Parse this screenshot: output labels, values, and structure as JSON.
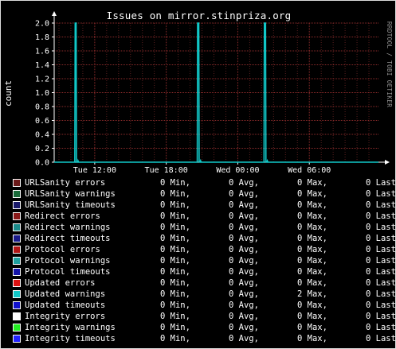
{
  "chart_data": {
    "type": "line",
    "title": "Issues on mirror.stinpriza.org",
    "ylabel": "count",
    "ylim": [
      0,
      2.0
    ],
    "yticks": [
      "0.0",
      "0.2",
      "0.4",
      "0.6",
      "0.8",
      "1.0",
      "1.2",
      "1.4",
      "1.6",
      "1.8",
      "2.0"
    ],
    "xticks": [
      "Tue 12:00",
      "Tue 18:00",
      "Wed 00:00",
      "Wed 06:00"
    ],
    "xlim_hours": [
      8.6,
      35.8
    ],
    "xtick_hours": [
      12,
      18,
      24,
      30
    ],
    "grid": true,
    "watermark": "RRDTOOL / TOBI OETIKER",
    "series": [
      {
        "name": "URLSanity errors",
        "color": "#6b1a1a",
        "min": "0",
        "avg": "0",
        "max": "0",
        "last": "Last"
      },
      {
        "name": "URLSanity warnings",
        "color": "#1a6b3a",
        "min": "0",
        "avg": "0",
        "max": "0",
        "last": "Last"
      },
      {
        "name": "URLSanity timeouts",
        "color": "#1a1a6b",
        "min": "0",
        "avg": "0",
        "max": "0",
        "last": "Last"
      },
      {
        "name": "Redirect errors",
        "color": "#8a1a1a",
        "min": "0",
        "avg": "0",
        "max": "0",
        "last": "Last"
      },
      {
        "name": "Redirect warnings",
        "color": "#1a8a8a",
        "min": "0",
        "avg": "0",
        "max": "0",
        "last": "Last"
      },
      {
        "name": "Redirect timeouts",
        "color": "#1a1a8a",
        "min": "0",
        "avg": "0",
        "max": "0",
        "last": "Last"
      },
      {
        "name": "Protocol errors",
        "color": "#b01515",
        "min": "0",
        "avg": "0",
        "max": "0",
        "last": "Last"
      },
      {
        "name": "Protocol warnings",
        "color": "#1fa0a0",
        "min": "0",
        "avg": "0",
        "max": "0",
        "last": "Last"
      },
      {
        "name": "Protocol timeouts",
        "color": "#1515a8",
        "min": "0",
        "avg": "0",
        "max": "0",
        "last": "Last"
      },
      {
        "name": "Updated errors",
        "color": "#dd1111",
        "min": "0",
        "avg": "0",
        "max": "0",
        "last": "Last"
      },
      {
        "name": "Updated warnings",
        "color": "#11c8c8",
        "min": "0",
        "avg": "0",
        "max": "2",
        "last": "Last",
        "points": [
          [
            8.6,
            0
          ],
          [
            10.33,
            0
          ],
          [
            10.36,
            2.0
          ],
          [
            10.44,
            2.0
          ],
          [
            10.47,
            0
          ],
          [
            10.58,
            0
          ],
          [
            10.6,
            0.02
          ],
          [
            10.65,
            0
          ],
          [
            20.6,
            0
          ],
          [
            20.63,
            2.0
          ],
          [
            20.73,
            2.0
          ],
          [
            20.76,
            0
          ],
          [
            20.85,
            0
          ],
          [
            20.88,
            0.02
          ],
          [
            20.93,
            0
          ],
          [
            26.2,
            0
          ],
          [
            26.23,
            2.0
          ],
          [
            26.33,
            2.0
          ],
          [
            26.36,
            0
          ],
          [
            26.45,
            0
          ],
          [
            26.48,
            0.02
          ],
          [
            26.53,
            0
          ],
          [
            35.8,
            0
          ]
        ]
      },
      {
        "name": "Updated timeouts",
        "color": "#1111cc",
        "min": "0",
        "avg": "0",
        "max": "0",
        "last": "Last"
      },
      {
        "name": "Integrity errors",
        "color": "#ffffff",
        "min": "0",
        "avg": "0",
        "max": "0",
        "last": "Last"
      },
      {
        "name": "Integrity warnings",
        "color": "#22ee22",
        "min": "0",
        "avg": "0",
        "max": "0",
        "last": "Last"
      },
      {
        "name": "Integrity timeouts",
        "color": "#2222ff",
        "min": "0",
        "avg": "0",
        "max": "0",
        "last": "Last"
      }
    ]
  },
  "labels": {
    "min": "Min,",
    "avg": "Avg,",
    "max": "Max,"
  }
}
